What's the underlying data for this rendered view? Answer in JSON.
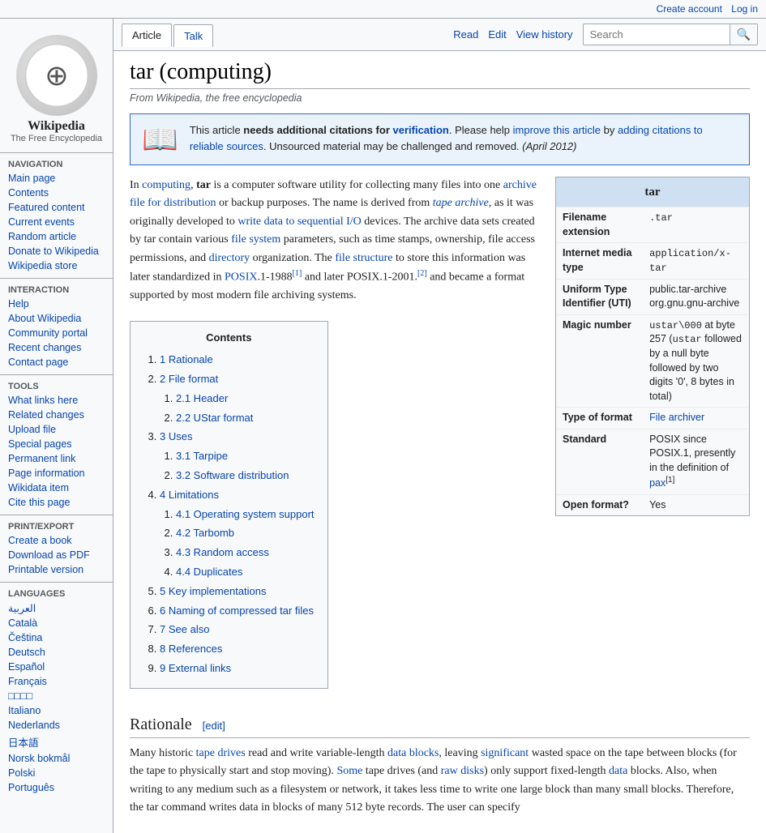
{
  "topbar": {
    "create_account": "Create account",
    "log_in": "Log in"
  },
  "tabs": {
    "article": "Article",
    "talk": "Talk",
    "read": "Read",
    "edit": "Edit",
    "view_history": "View history",
    "search_placeholder": "Search"
  },
  "sidebar": {
    "logo_icon": "🌐",
    "logo_title": "Wikipedia",
    "logo_subtitle": "The Free Encyclopedia",
    "navigation_title": "Navigation",
    "nav_items": [
      {
        "label": "Main page",
        "href": "#"
      },
      {
        "label": "Contents",
        "href": "#"
      },
      {
        "label": "Featured content",
        "href": "#"
      },
      {
        "label": "Current events",
        "href": "#"
      },
      {
        "label": "Random article",
        "href": "#"
      },
      {
        "label": "Donate to Wikipedia",
        "href": "#"
      },
      {
        "label": "Wikipedia store",
        "href": "#"
      }
    ],
    "interaction_title": "Interaction",
    "interaction_items": [
      {
        "label": "Help",
        "href": "#"
      },
      {
        "label": "About Wikipedia",
        "href": "#"
      },
      {
        "label": "Community portal",
        "href": "#"
      },
      {
        "label": "Recent changes",
        "href": "#"
      },
      {
        "label": "Contact page",
        "href": "#"
      }
    ],
    "tools_title": "Tools",
    "tools_items": [
      {
        "label": "What links here",
        "href": "#"
      },
      {
        "label": "Related changes",
        "href": "#"
      },
      {
        "label": "Upload file",
        "href": "#"
      },
      {
        "label": "Special pages",
        "href": "#"
      },
      {
        "label": "Permanent link",
        "href": "#"
      },
      {
        "label": "Page information",
        "href": "#"
      },
      {
        "label": "Wikidata item",
        "href": "#"
      },
      {
        "label": "Cite this page",
        "href": "#"
      }
    ],
    "print_title": "Print/export",
    "print_items": [
      {
        "label": "Create a book",
        "href": "#"
      },
      {
        "label": "Download as PDF",
        "href": "#"
      },
      {
        "label": "Printable version",
        "href": "#"
      }
    ],
    "languages_title": "Languages",
    "language_items": [
      {
        "label": "العربية",
        "href": "#"
      },
      {
        "label": "Català",
        "href": "#"
      },
      {
        "label": "Čeština",
        "href": "#"
      },
      {
        "label": "Deutsch",
        "href": "#"
      },
      {
        "label": "Español",
        "href": "#"
      },
      {
        "label": "Français",
        "href": "#"
      },
      {
        "label": "□□□□",
        "href": "#"
      },
      {
        "label": "Italiano",
        "href": "#"
      },
      {
        "label": "Nederlands",
        "href": "#"
      },
      {
        "label": "日本語",
        "href": "#"
      },
      {
        "label": "Norsk bokmål",
        "href": "#"
      },
      {
        "label": "Polski",
        "href": "#"
      },
      {
        "label": "Português",
        "href": "#"
      }
    ]
  },
  "article": {
    "title": "tar (computing)",
    "subtitle": "From Wikipedia, the free encyclopedia",
    "warning": {
      "icon": "📖",
      "text_start": "This article ",
      "needs_text": "needs additional citations for",
      "verification_link": "verification",
      "text_mid": ". Please help ",
      "improve_link": "improve this article",
      "text_mid2": " by ",
      "adding_link": "adding citations to reliable sources",
      "text_end": ". Unsourced material may be challenged and removed.",
      "date": "(April 2012)"
    },
    "intro": "In computing, tar is a computer software utility for collecting many files into one archive file for distribution or backup purposes. The name is derived from tape archive, as it was originally developed to write data to sequential I/O devices. The archive data sets created by tar contain various file system parameters, such as time stamps, ownership, file access permissions, and directory organization. The file structure to store this information was later standardized in POSIX.1-1988 and later POSIX.1-2001. and became a format supported by most modern file archiving systems.",
    "infobox": {
      "title": "tar",
      "rows": [
        {
          "label": "Filename extension",
          "value": ".tar"
        },
        {
          "label": "Internet media type",
          "value": "application/x-tar"
        },
        {
          "label": "Uniform Type Identifier (UTI)",
          "value": "public.tar-archive org.gnu.gnu-archive"
        },
        {
          "label": "Magic number",
          "value": "ustar\\000 at byte 257 (ustar followed by a null byte followed by two digits '0', 8 bytes in total)"
        },
        {
          "label": "Type of format",
          "value": "File archiver"
        },
        {
          "label": "Standard",
          "value": "POSIX since POSIX.1, presently in the definition of pax"
        },
        {
          "label": "Open format?",
          "value": "Yes"
        }
      ]
    },
    "toc": {
      "title": "Contents",
      "items": [
        {
          "num": "1",
          "label": "Rationale",
          "href": "#rationale",
          "sub": []
        },
        {
          "num": "2",
          "label": "File format",
          "href": "#file-format",
          "sub": [
            {
              "num": "2.1",
              "label": "Header",
              "href": "#header"
            },
            {
              "num": "2.2",
              "label": "UStar format",
              "href": "#ustar-format"
            }
          ]
        },
        {
          "num": "3",
          "label": "Uses",
          "href": "#uses",
          "sub": [
            {
              "num": "3.1",
              "label": "Tarpipe",
              "href": "#tarpipe"
            },
            {
              "num": "3.2",
              "label": "Software distribution",
              "href": "#software-distribution"
            }
          ]
        },
        {
          "num": "4",
          "label": "Limitations",
          "href": "#limitations",
          "sub": [
            {
              "num": "4.1",
              "label": "Operating system support",
              "href": "#os-support"
            },
            {
              "num": "4.2",
              "label": "Tarbomb",
              "href": "#tarbomb"
            },
            {
              "num": "4.3",
              "label": "Random access",
              "href": "#random-access"
            },
            {
              "num": "4.4",
              "label": "Duplicates",
              "href": "#duplicates"
            }
          ]
        },
        {
          "num": "5",
          "label": "Key implementations",
          "href": "#key-implementations",
          "sub": []
        },
        {
          "num": "6",
          "label": "Naming of compressed tar files",
          "href": "#naming",
          "sub": []
        },
        {
          "num": "7",
          "label": "See also",
          "href": "#see-also",
          "sub": []
        },
        {
          "num": "8",
          "label": "References",
          "href": "#references",
          "sub": []
        },
        {
          "num": "9",
          "label": "External links",
          "href": "#external-links",
          "sub": []
        }
      ]
    },
    "rationale_heading": "Rationale",
    "rationale_edit": "[edit]",
    "rationale_text": "Many historic tape drives read and write variable-length data blocks, leaving significant wasted space on the tape between blocks (for the tape to physically start and stop moving). Some tape drives (and raw disks) only support fixed-length data blocks. Also, when writing to any medium such as a filesystem or network, it takes less time to write one large block than many small blocks. Therefore, the tar command writes data in blocks of many 512 byte records. The user can specify"
  }
}
